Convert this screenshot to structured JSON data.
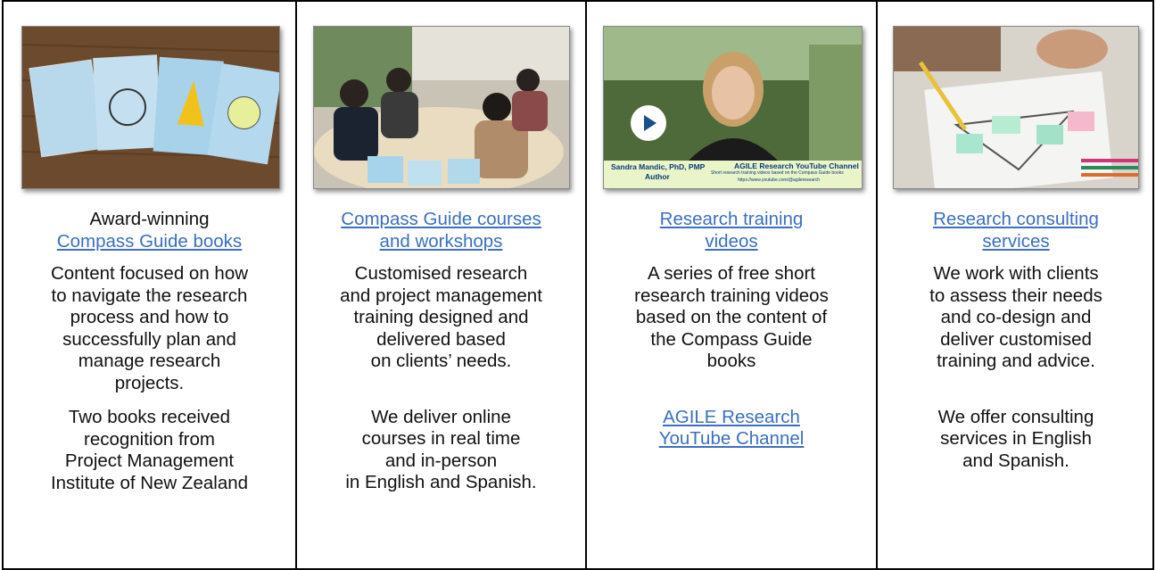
{
  "columns": [
    {
      "heading_prefix": "Award-winning",
      "link_lines": [
        "Compass Guide books"
      ],
      "body_lines": [
        "Content focused on how",
        "to navigate the research",
        "process and how to",
        "successfully plan and",
        "manage research",
        "projects."
      ],
      "footer_lines": [
        "Two books received",
        "recognition from",
        "Project Management",
        "Institute of New Zealand"
      ]
    },
    {
      "heading_prefix": "",
      "link_lines": [
        "Compass Guide courses",
        "and workshops"
      ],
      "body_lines": [
        "Customised research",
        "and project management",
        "training designed and",
        "delivered based",
        "on clients’ needs."
      ],
      "footer_lines": [
        "We deliver online",
        "courses in real time",
        "and in-person",
        "in English and Spanish."
      ]
    },
    {
      "heading_prefix": "",
      "link_lines": [
        "Research training",
        "videos"
      ],
      "body_lines": [
        "A series of free short",
        "research training videos",
        "based on the content of",
        "the Compass Guide",
        "books"
      ],
      "footer_link_lines": [
        "AGILE Research",
        "YouTube Channel"
      ],
      "video_caption": {
        "presenter": "Sandra Mandic, PhD, PMP",
        "role": "Author",
        "channel": "AGILE Research YouTube Channel",
        "desc": "Short research training videos based on the Compass Guide books",
        "url": "https://www.youtube.com/@agileresearch"
      }
    },
    {
      "heading_prefix": "",
      "link_lines": [
        "Research consulting",
        "services"
      ],
      "body_lines": [
        "We work with clients",
        "to assess their needs",
        "and co-design and",
        "deliver customised",
        "training and advice."
      ],
      "footer_lines": [
        "We offer consulting",
        "services in English",
        "and Spanish."
      ]
    }
  ],
  "colors": {
    "link": "#3b6fbf",
    "border": "#000000"
  },
  "icons": [
    "play-icon"
  ]
}
